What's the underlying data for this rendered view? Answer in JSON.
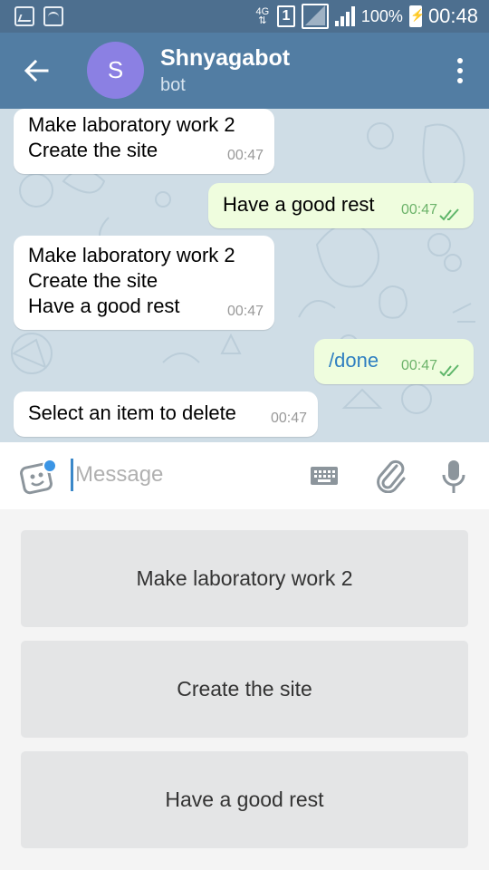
{
  "status_bar": {
    "network": "4G",
    "network_arrows": "⇅",
    "sim_slot": "1",
    "battery": "100%",
    "time": "00:48"
  },
  "header": {
    "avatar_letter": "S",
    "avatar_color": "#8b80e3",
    "title": "Shnyagabot",
    "subtitle": "bot"
  },
  "messages": [
    {
      "direction": "in",
      "lines": [
        "Make laboratory work 2",
        "Create the site"
      ],
      "time": "00:47"
    },
    {
      "direction": "out",
      "lines": [
        "Have a good rest"
      ],
      "time": "00:47",
      "read": true
    },
    {
      "direction": "in",
      "lines": [
        "Make laboratory work 2",
        "Create the site",
        "Have a good rest"
      ],
      "time": "00:47"
    },
    {
      "direction": "out",
      "lines": [
        "/done"
      ],
      "time": "00:47",
      "read": true
    },
    {
      "direction": "in",
      "lines": [
        "Select an item to delete"
      ],
      "time": "00:47"
    }
  ],
  "composer": {
    "placeholder": "Message",
    "value": ""
  },
  "reply_keyboard": [
    {
      "label": "Make laboratory work 2"
    },
    {
      "label": "Create the site"
    },
    {
      "label": "Have a good rest"
    }
  ],
  "colors": {
    "header": "#527da3",
    "status_bar": "#4d6f8f",
    "chat_background": "#cfdde6",
    "outgoing_bubble": "#effdde",
    "accent": "#3b95e5"
  }
}
